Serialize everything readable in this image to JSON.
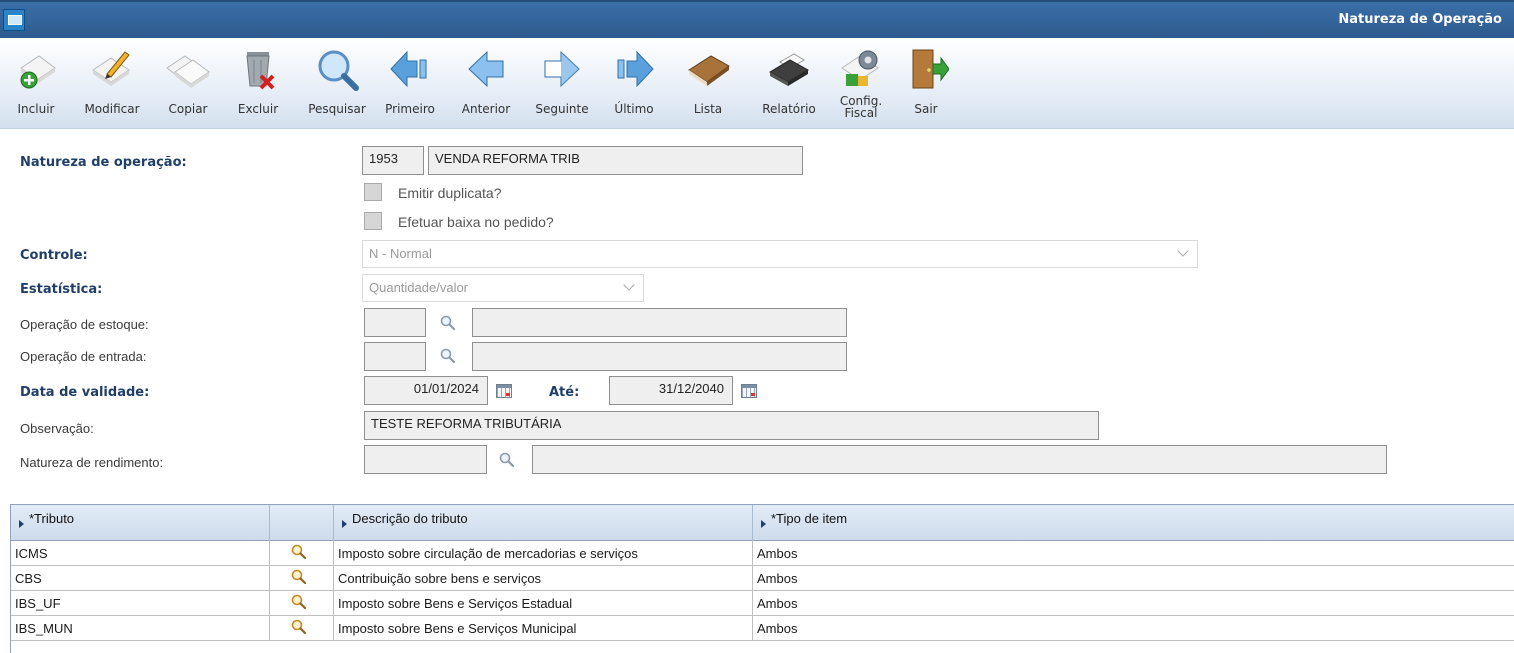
{
  "window": {
    "title": "Natureza de Operação"
  },
  "toolbar": {
    "incluir": "Incluir",
    "modificar": "Modificar",
    "copiar": "Copiar",
    "excluir": "Excluir",
    "pesquisar": "Pesquisar",
    "primeiro": "Primeiro",
    "anterior": "Anterior",
    "seguinte": "Seguinte",
    "ultimo": "Último",
    "lista": "Lista",
    "relatorio": "Relatório",
    "config_line1": "Config.",
    "config_line2": "Fiscal",
    "sair": "Sair"
  },
  "form": {
    "natureza_label": "Natureza de operação:",
    "natureza_code": "1953",
    "natureza_desc": "VENDA REFORMA TRIB",
    "emitir_duplicata": "Emitir duplicata?",
    "efetuar_baixa": "Efetuar baixa no pedido?",
    "controle_label": "Controle:",
    "controle_value": "N - Normal",
    "estatistica_label": "Estatística:",
    "estatistica_value": "Quantidade/valor",
    "op_estoque_label": "Operação de estoque:",
    "op_entrada_label": "Operação de entrada:",
    "data_validade_label": "Data de validade:",
    "data_inicio": "01/01/2024",
    "ate_label": "Até:",
    "data_fim": "31/12/2040",
    "observacao_label": "Observação:",
    "observacao_value": "TESTE REFORMA TRIBUTÁRIA",
    "natureza_rend_label": "Natureza de rendimento:"
  },
  "grid": {
    "columns": [
      "*Tributo",
      "",
      "Descrição do tributo",
      "*Tipo de item"
    ],
    "rows": [
      {
        "tributo": "ICMS",
        "descricao": "Imposto sobre circulação de mercadorias e serviços",
        "tipo": "Ambos"
      },
      {
        "tributo": "CBS",
        "descricao": "Contribuição sobre bens e serviços",
        "tipo": "Ambos"
      },
      {
        "tributo": "IBS_UF",
        "descricao": "Imposto sobre Bens e Serviços Estadual",
        "tipo": "Ambos"
      },
      {
        "tributo": "IBS_MUN",
        "descricao": "Imposto sobre Bens e Serviços Municipal",
        "tipo": "Ambos"
      }
    ]
  }
}
